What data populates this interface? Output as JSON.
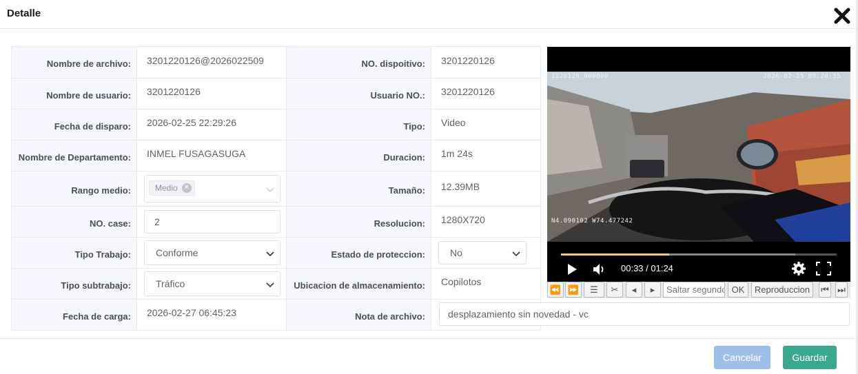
{
  "dialog": {
    "title": "Detalle"
  },
  "fields": {
    "file_name": {
      "label": "Nombre de archivo:",
      "value": "3201220126@2026022509"
    },
    "device_no": {
      "label": "NO. dispoitivo:",
      "value": "3201220126"
    },
    "user_name": {
      "label": "Nombre de usuario:",
      "value": "3201220126"
    },
    "user_no": {
      "label": "Usuario NO.:",
      "value": "3201220126"
    },
    "trigger_date": {
      "label": "Fecha de disparo:",
      "value": "2026-02-25 22:29:26"
    },
    "type": {
      "label": "Tipo:",
      "value": "Video"
    },
    "department": {
      "label": "Nombre de Departamento:",
      "value": "INMEL FUSAGASUGA"
    },
    "duration": {
      "label": "Duracion:",
      "value": "1m 24s"
    },
    "range": {
      "label": "Rango medio:",
      "tag": "Medio"
    },
    "size": {
      "label": "Tamaño:",
      "value": "12.39MB"
    },
    "case_no": {
      "label": "NO. case:",
      "value": "2"
    },
    "resolution": {
      "label": "Resolucion:",
      "value": "1280X720"
    },
    "work_type": {
      "label": "Tipo Trabajo:",
      "value": "Conforme"
    },
    "protection": {
      "label": "Estado de proteccion:",
      "value": "No"
    },
    "sub_work_type": {
      "label": "Tipo subtrabajo:",
      "value": "Tráfico"
    },
    "storage": {
      "label": "Ubicacion de almacenamiento:",
      "value": "Copilotos"
    },
    "upload_date": {
      "label": "Fecha de carga:",
      "value": "2026-02-27 06:45:23"
    },
    "note": {
      "label": "Nota de archivo:",
      "value": "desplazamiento sin novedad - vc"
    }
  },
  "video": {
    "osd_top_left": "1220126_000000",
    "osd_top_right": "2026-02-25 09:28:35",
    "osd_coords": "N4.090102  W74.477242",
    "time": "00:33 / 01:24",
    "played_fraction": 0.393,
    "buffered_fraction": 0.85
  },
  "toolbar": {
    "skip_placeholder": "Saltar segundos",
    "ok_label": "OK",
    "playback_label": "Reproduccion"
  },
  "footer": {
    "cancel_label": "Cancelar",
    "save_label": "Guardar"
  },
  "colors": {
    "primary_light": "#a0bfe8",
    "success": "#3aa78f",
    "progress": "#e8c98a"
  },
  "icons": [
    "close-icon",
    "chevron-down-icon",
    "tag-close-icon",
    "play-icon",
    "volume-icon",
    "settings-icon",
    "fullscreen-icon",
    "rewind-icon",
    "fast-forward-icon",
    "list-icon",
    "scissors-icon",
    "prev-frame-icon",
    "next-frame-icon",
    "skip-start-icon",
    "skip-end-icon"
  ]
}
